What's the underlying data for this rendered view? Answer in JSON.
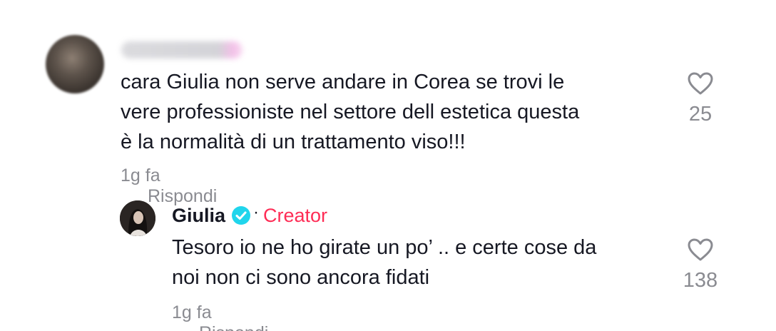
{
  "comment": {
    "text": "cara Giulia non serve andare in Corea se trovi le\nvere professioniste nel settore dell estetica questa\nè la normalità di un trattamento viso!!!",
    "time": "1g fa",
    "reply_label": "Rispondi",
    "likes": "25"
  },
  "reply": {
    "username": "Giulia",
    "dot": "·",
    "badge_label": "Creator",
    "text": "Tesoro io ne ho girate un po’ .. e certe cose da\nnoi non ci sono ancora fidati",
    "time": "1g fa",
    "reply_label": "Rispondi",
    "likes": "138"
  },
  "colors": {
    "creator": "#fe2c55",
    "verified": "#20d5ec",
    "secondary_text": "#8a8b91",
    "primary_text": "#161823"
  },
  "icons": {
    "like": "heart-outline-icon",
    "verified": "verified-badge-icon"
  }
}
